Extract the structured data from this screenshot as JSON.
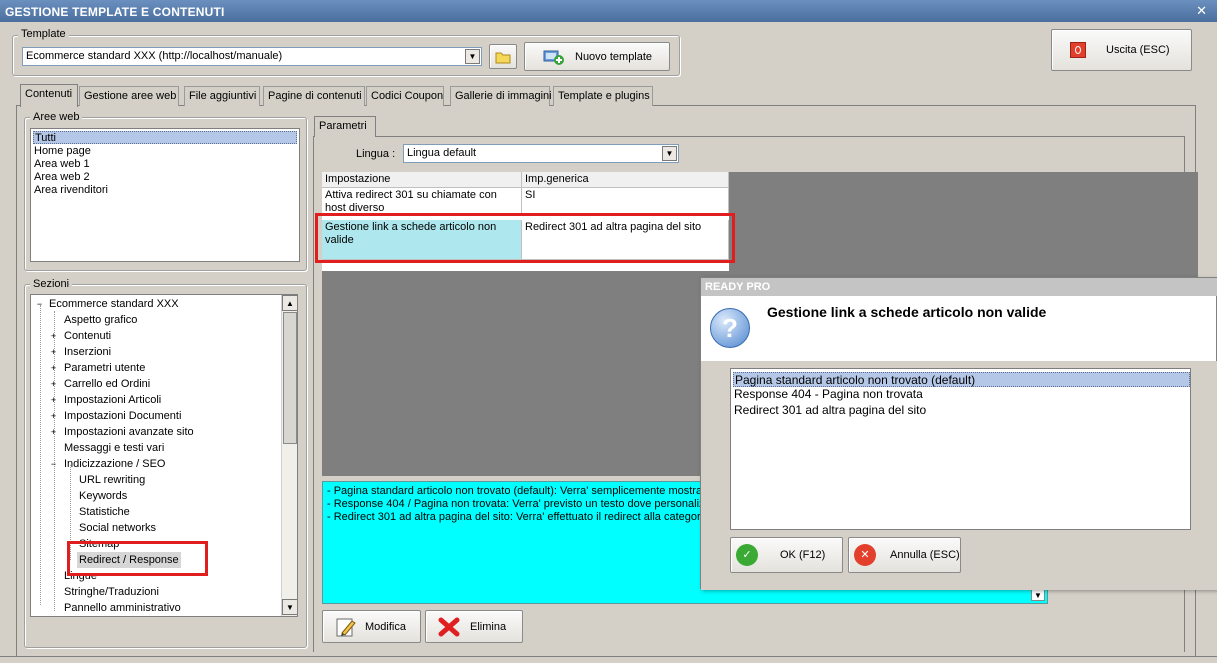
{
  "window": {
    "title": "GESTIONE TEMPLATE E CONTENUTI"
  },
  "template_group": {
    "label": "Template",
    "selected": "Ecommerce standard XXX (http://localhost/manuale)",
    "new_template_label": "Nuovo template"
  },
  "exit_button": {
    "label": "Uscita (ESC)"
  },
  "tabs": [
    {
      "label": "Contenuti"
    },
    {
      "label": "Gestione aree web"
    },
    {
      "label": "File aggiuntivi"
    },
    {
      "label": "Pagine di contenuti"
    },
    {
      "label": "Codici Coupon"
    },
    {
      "label": "Gallerie di immagini"
    },
    {
      "label": "Template e plugins"
    }
  ],
  "aree_web": {
    "label": "Aree web",
    "items": [
      "Tutti",
      "Home page",
      "Area web 1",
      "Area web 2",
      "Area rivenditori"
    ],
    "selected_index": 0
  },
  "sezioni": {
    "label": "Sezioni",
    "root": "Ecommerce standard XXX",
    "items": [
      "Aspetto grafico",
      "Contenuti",
      "Inserzioni",
      "Parametri utente",
      "Carrello ed Ordini",
      "Impostazioni Articoli",
      "Impostazioni Documenti",
      "Impostazioni avanzate sito",
      "Messaggi e testi vari",
      "Indicizzazione / SEO",
      "URL rewriting",
      "Keywords",
      "Statistiche",
      "Social networks",
      "Sitemap",
      "Redirect / Response",
      "Lingue",
      "Stringhe/Traduzioni",
      "Pannello amministrativo"
    ]
  },
  "parametri": {
    "tab_label": "Parametri",
    "lingua_label": "Lingua :",
    "lingua_value": "Lingua default",
    "columns": [
      "Impostazione",
      "Imp.generica"
    ],
    "rows": [
      {
        "setting": "Attiva redirect 301 su chiamate con host diverso",
        "value": "SI"
      },
      {
        "setting": "Gestione link a schede articolo non valide",
        "value": "Redirect 301 ad altra pagina del sito"
      }
    ],
    "description_lines": [
      "- Pagina standard articolo non trovato (default): Verra' semplicemente mostrat",
      "- Response 404 / Pagina non trovata: Verra' previsto un testo dove personaliz",
      "- Redirect 301 ad altra pagina del sito: Verra' effettuato il redirect alla categori"
    ],
    "modifica_label": "Modifica",
    "elimina_label": "Elimina"
  },
  "dialog": {
    "title": "READY PRO",
    "question": "Gestione link a schede articolo non valide",
    "options": [
      "Pagina standard articolo non trovato (default)",
      "Response 404 - Pagina non trovata",
      "Redirect 301 ad altra pagina del sito"
    ],
    "selected_index": 0,
    "ok_label": "OK (F12)",
    "cancel_label": "Annulla (ESC)"
  },
  "colors": {
    "titlebar": "#5a7fae",
    "highlight_red": "#e01e1e",
    "description_bg": "#00ffff",
    "grid_selected_bg": "#aee8ee"
  }
}
